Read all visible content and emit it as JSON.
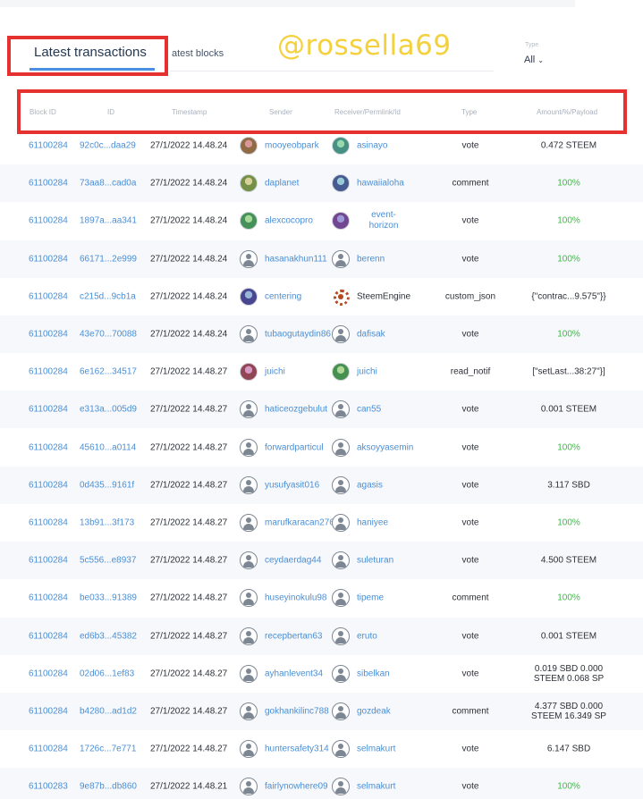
{
  "watermark": "@rossella69",
  "tabs": {
    "latest_transactions": "Latest transactions",
    "latest_blocks": "atest blocks"
  },
  "type_filter": {
    "label": "Type",
    "value": "All"
  },
  "columns": {
    "block_id": "Block ID",
    "id": "ID",
    "timestamp": "Timestamp",
    "sender": "Sender",
    "receiver": "Receiver/Permlink/Id",
    "type": "Type",
    "amount": "Amount/%/Payload"
  },
  "colors": {
    "link": "#4a8fd6",
    "green": "#41b649",
    "highlight_red": "#e5312f",
    "watermark_yellow": "#f4d13c",
    "tab_underline": "#4a90e2"
  },
  "rows": [
    {
      "block": "61100284",
      "id": "92c0c...daa29",
      "ts": "27/1/2022 14.48.24",
      "sender": "mooyeobpark",
      "sender_avatar": "photo",
      "receiver": "asinayo",
      "receiver_avatar": "photo",
      "type": "vote",
      "amount1": "0.472 STEEM",
      "amount2": "",
      "amount_color": "dark"
    },
    {
      "block": "61100284",
      "id": "73aa8...cad0a",
      "ts": "27/1/2022 14.48.24",
      "sender": "daplanet",
      "sender_avatar": "photo",
      "receiver": "hawaiialoha",
      "receiver_avatar": "photo",
      "type": "comment",
      "amount1": "100%",
      "amount2": "",
      "amount_color": "green"
    },
    {
      "block": "61100284",
      "id": "1897a...aa341",
      "ts": "27/1/2022 14.48.24",
      "sender": "alexcocopro",
      "sender_avatar": "photo",
      "receiver": "event-horizon",
      "receiver_wrap": true,
      "receiver_avatar": "photo",
      "type": "vote",
      "amount1": "100%",
      "amount2": "",
      "amount_color": "green"
    },
    {
      "block": "61100284",
      "id": "66171...2e999",
      "ts": "27/1/2022 14.48.24",
      "sender": "hasanakhun111",
      "sender_avatar": "default",
      "receiver": "berenn",
      "receiver_avatar": "default",
      "type": "vote",
      "amount1": "100%",
      "amount2": "",
      "amount_color": "green"
    },
    {
      "block": "61100284",
      "id": "c215d...9cb1a",
      "ts": "27/1/2022 14.48.24",
      "sender": "centering",
      "sender_avatar": "photo",
      "receiver": "SteemEngine",
      "receiver_dark": true,
      "receiver_avatar": "gear",
      "type": "custom_json",
      "amount1": "{\"contrac...9.575\"}}",
      "amount2": "",
      "amount_color": "dark"
    },
    {
      "block": "61100284",
      "id": "43e70...70088",
      "ts": "27/1/2022 14.48.24",
      "sender": "tubaogutaydin86",
      "sender_avatar": "default",
      "receiver": "dafisak",
      "receiver_avatar": "default",
      "type": "vote",
      "amount1": "100%",
      "amount2": "",
      "amount_color": "green"
    },
    {
      "block": "61100284",
      "id": "6e162...34517",
      "ts": "27/1/2022 14.48.27",
      "sender": "juichi",
      "sender_avatar": "photo",
      "receiver": "juichi",
      "receiver_avatar": "photo",
      "type": "read_notif",
      "amount1": "[\"setLast...38:27\"}]",
      "amount2": "",
      "amount_color": "dark"
    },
    {
      "block": "61100284",
      "id": "e313a...005d9",
      "ts": "27/1/2022 14.48.27",
      "sender": "haticeozgebulut",
      "sender_avatar": "default",
      "receiver": "can55",
      "receiver_avatar": "default",
      "type": "vote",
      "amount1": "0.001 STEEM",
      "amount2": "",
      "amount_color": "dark"
    },
    {
      "block": "61100284",
      "id": "45610...a0114",
      "ts": "27/1/2022 14.48.27",
      "sender": "forwardparticul",
      "sender_avatar": "default",
      "receiver": "aksoyyasemin",
      "receiver_avatar": "default",
      "type": "vote",
      "amount1": "100%",
      "amount2": "",
      "amount_color": "green"
    },
    {
      "block": "61100284",
      "id": "0d435...9161f",
      "ts": "27/1/2022 14.48.27",
      "sender": "yusufyasit016",
      "sender_avatar": "default",
      "receiver": "agasis",
      "receiver_avatar": "default",
      "type": "vote",
      "amount1": "3.117 SBD",
      "amount2": "",
      "amount_color": "dark"
    },
    {
      "block": "61100284",
      "id": "13b91...3f173",
      "ts": "27/1/2022 14.48.27",
      "sender": "marufkaracan276",
      "sender_avatar": "default",
      "receiver": "haniyee",
      "receiver_avatar": "default",
      "type": "vote",
      "amount1": "100%",
      "amount2": "",
      "amount_color": "green"
    },
    {
      "block": "61100284",
      "id": "5c556...e8937",
      "ts": "27/1/2022 14.48.27",
      "sender": "ceydaerdag44",
      "sender_avatar": "default",
      "receiver": "suleturan",
      "receiver_avatar": "default",
      "type": "vote",
      "amount1": "4.500 STEEM",
      "amount2": "",
      "amount_color": "dark"
    },
    {
      "block": "61100284",
      "id": "be033...91389",
      "ts": "27/1/2022 14.48.27",
      "sender": "huseyinokulu98",
      "sender_avatar": "default",
      "receiver": "tipeme",
      "receiver_avatar": "default",
      "type": "comment",
      "amount1": "100%",
      "amount2": "",
      "amount_color": "green"
    },
    {
      "block": "61100284",
      "id": "ed6b3...45382",
      "ts": "27/1/2022 14.48.27",
      "sender": "recepbertan63",
      "sender_avatar": "default",
      "receiver": "eruto",
      "receiver_avatar": "default",
      "type": "vote",
      "amount1": "0.001 STEEM",
      "amount2": "",
      "amount_color": "dark"
    },
    {
      "block": "61100284",
      "id": "02d06...1ef83",
      "ts": "27/1/2022 14.48.27",
      "sender": "ayhanlevent34",
      "sender_avatar": "default",
      "receiver": "sibelkan",
      "receiver_avatar": "default",
      "type": "vote",
      "amount1": "0.019 SBD 0.000",
      "amount2": "STEEM 0.068 SP",
      "amount_color": "dark"
    },
    {
      "block": "61100284",
      "id": "b4280...ad1d2",
      "ts": "27/1/2022 14.48.27",
      "sender": "gokhankilinc788",
      "sender_avatar": "default",
      "receiver": "gozdeak",
      "receiver_avatar": "default",
      "type": "comment",
      "amount1": "4.377 SBD 0.000",
      "amount2": "STEEM 16.349 SP",
      "amount_color": "dark"
    },
    {
      "block": "61100284",
      "id": "1726c...7e771",
      "ts": "27/1/2022 14.48.27",
      "sender": "huntersafety314",
      "sender_avatar": "default",
      "receiver": "selmakurt",
      "receiver_avatar": "default",
      "type": "vote",
      "amount1": "6.147 SBD",
      "amount2": "",
      "amount_color": "dark"
    },
    {
      "block": "61100283",
      "id": "9e87b...db860",
      "ts": "27/1/2022 14.48.21",
      "sender": "fairlynowhere09",
      "sender_avatar": "default",
      "receiver": "selmakurt",
      "receiver_avatar": "default",
      "type": "vote",
      "amount1": "100%",
      "amount2": "",
      "amount_color": "green"
    }
  ]
}
